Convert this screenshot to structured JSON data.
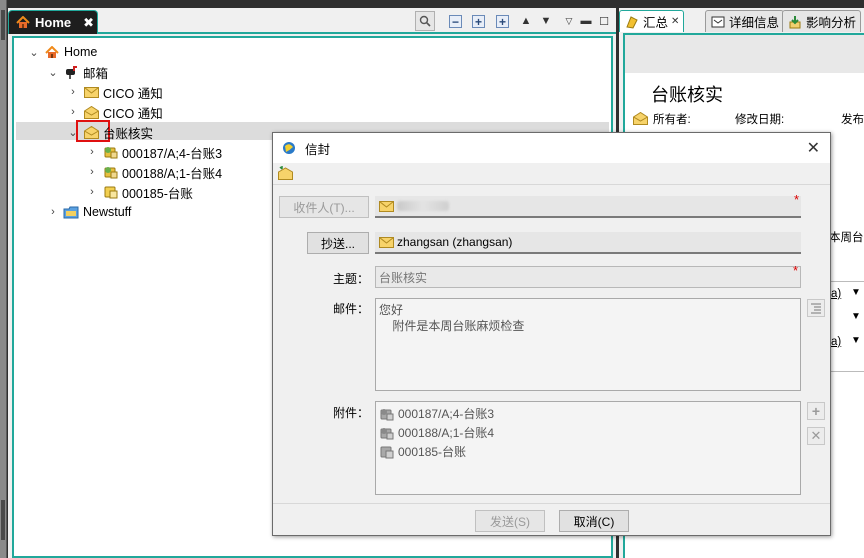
{
  "left_view": {
    "tab_label": "Home",
    "tree": [
      {
        "label": "Home"
      },
      {
        "label": "邮箱"
      },
      {
        "label": "CICO 通知"
      },
      {
        "label": "CICO 通知"
      },
      {
        "label": "台账核实"
      },
      {
        "label": "000187/A;4-台账3"
      },
      {
        "label": "000188/A;1-台账4"
      },
      {
        "label": "000185-台账"
      },
      {
        "label": "Newstuff"
      }
    ]
  },
  "right_view": {
    "tabs": [
      {
        "label": "汇总"
      },
      {
        "label": "详细信息"
      },
      {
        "label": "影响分析"
      }
    ],
    "title": "台账核实",
    "owner_label": "所有者:",
    "modified_label": "修改日期:",
    "release_label": "发布",
    "partial_text": "本周台",
    "link_fragment_1": "a)",
    "link_fragment_2": "a)"
  },
  "dialog": {
    "title": "信封",
    "recipient_button": "收件人(T)...",
    "recipient_value": "",
    "cc_button": "抄送...",
    "cc_value": "zhangsan (zhangsan)",
    "subject_label": "主题：",
    "subject_value": "台账核实",
    "body_label": "邮件：",
    "body_lines": [
      "您好",
      "    附件是本周台账麻烦检查"
    ],
    "attachments_label": "附件：",
    "attachments": [
      {
        "name": "000187/A;4-台账3"
      },
      {
        "name": "000188/A;1-台账4"
      },
      {
        "name": "000185-台账"
      }
    ],
    "send_button": "发送(S)",
    "cancel_button": "取消(C)"
  },
  "colors": {
    "accent": "#21a89b",
    "highlight_box": "#e01010",
    "required": "#d00000"
  }
}
